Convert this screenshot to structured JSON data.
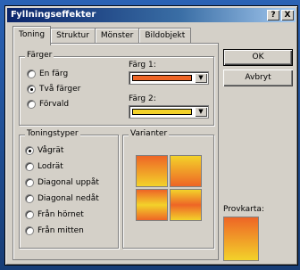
{
  "window": {
    "title": "Fyllningseffekter",
    "help": "?",
    "close": "X"
  },
  "tabs": [
    "Toning",
    "Struktur",
    "Mönster",
    "Bildobjekt"
  ],
  "farger": {
    "group_label": "Färger",
    "options": [
      "En färg",
      "Två färger",
      "Förvald"
    ],
    "selected_index": 1,
    "color1_label": "Färg 1:",
    "color2_label": "Färg 2:",
    "color1": "#ee6526",
    "color2": "#f3d22a"
  },
  "toningstyper": {
    "group_label": "Toningstyper",
    "options": [
      "Vågrät",
      "Lodrät",
      "Diagonal uppåt",
      "Diagonal nedåt",
      "Från hörnet",
      "Från mitten"
    ],
    "selected_index": 0
  },
  "varianter": {
    "group_label": "Varianter"
  },
  "buttons": {
    "ok": "OK",
    "cancel": "Avbryt"
  },
  "preview": {
    "label": "Provkarta:"
  },
  "icons": {
    "dropdown_arrow": "▼"
  }
}
